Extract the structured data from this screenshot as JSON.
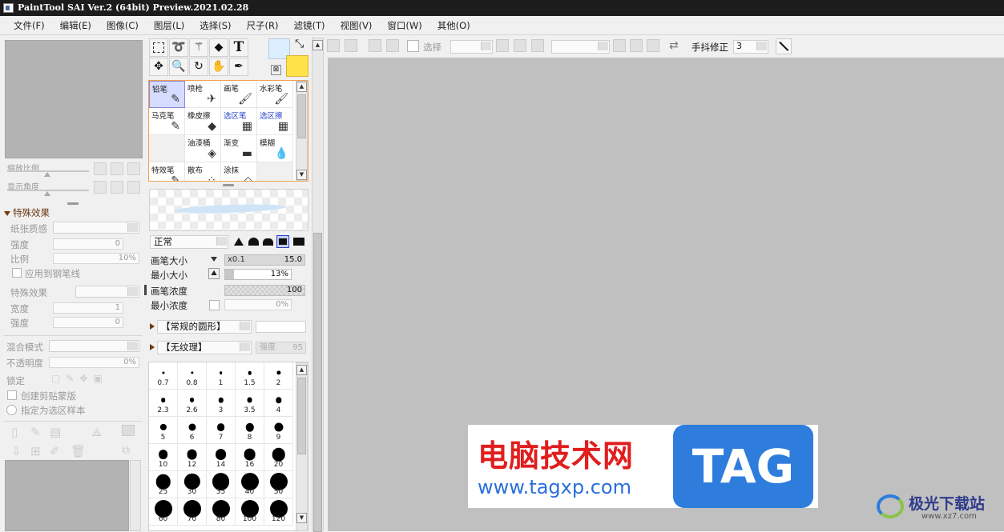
{
  "window": {
    "title": "PaintTool SAI Ver.2 (64bit) Preview.2021.02.28"
  },
  "menu": [
    "文件(F)",
    "编辑(E)",
    "图像(C)",
    "图层(L)",
    "选择(S)",
    "尺子(R)",
    "滤镜(T)",
    "视图(V)",
    "窗口(W)",
    "其他(O)"
  ],
  "nav": {
    "zoom_label": "缩放比例",
    "angle_label": "显示角度"
  },
  "effects": {
    "header": "特殊效果",
    "paper_label": "纸张质感",
    "strength_label": "强度",
    "strength_value": "0",
    "scale_label": "比例",
    "scale_value": "10%",
    "apply_pen_label": "应用到钢笔线",
    "effect_label": "特殊效果",
    "width_label": "宽度",
    "width_value": "1",
    "strength2_label": "强度",
    "strength2_value": "0"
  },
  "layer": {
    "blend_label": "混合模式",
    "opacity_label": "不透明度",
    "opacity_value": "0%",
    "lock_label": "锁定",
    "clip_label": "创建剪贴蒙版",
    "sample_label": "指定为选区样本"
  },
  "colors": {
    "fg": "#dbeeff",
    "bg": "#ffe24a",
    "accent": "#f0a050",
    "selected_tool": "#d6dcff"
  },
  "tools": {
    "grid": [
      {
        "name": "铅笔",
        "icon": "✎",
        "selected": true
      },
      {
        "name": "喷枪",
        "icon": "✈"
      },
      {
        "name": "画笔",
        "icon": "🖌"
      },
      {
        "name": "水彩笔",
        "icon": "🖌"
      },
      {
        "name": "马克笔",
        "icon": "✎"
      },
      {
        "name": "橡皮擦",
        "icon": "◆"
      },
      {
        "name": "选区笔",
        "icon": "▦",
        "blue": true
      },
      {
        "name": "选区擦",
        "icon": "▦",
        "blue": true
      },
      {
        "name": "",
        "icon": ""
      },
      {
        "name": "油漆桶",
        "icon": "◈"
      },
      {
        "name": "渐变",
        "icon": "▬"
      },
      {
        "name": "模糊",
        "icon": "💧"
      },
      {
        "name": "特效笔",
        "icon": "✎"
      },
      {
        "name": "散布",
        "icon": "⁘"
      },
      {
        "name": "涂抹",
        "icon": "◇"
      },
      {
        "name": "",
        "icon": ""
      }
    ]
  },
  "brush": {
    "mode": "正常",
    "size_label": "画笔大小",
    "size_mult": "x0.1",
    "size_value": "15.0",
    "min_size_label": "最小大小",
    "min_size_value": "13%",
    "density_label": "画笔浓度",
    "density_value": "100",
    "min_density_label": "最小浓度",
    "min_density_value": "0%",
    "shape": "【常规的圆形】",
    "texture": "【无纹理】",
    "texture_strength": "强度",
    "texture_strength_value": "95",
    "sizes": [
      "0.7",
      "0.8",
      "1",
      "1.5",
      "2",
      "2.3",
      "2.6",
      "3",
      "3.5",
      "4",
      "5",
      "6",
      "7",
      "8",
      "9",
      "10",
      "12",
      "14",
      "16",
      "20",
      "25",
      "30",
      "35",
      "40",
      "50",
      "60",
      "70",
      "80",
      "100",
      "120"
    ]
  },
  "toolbar": {
    "select_label": "选择",
    "stabilizer_label": "手抖修正",
    "stabilizer_value": "3"
  },
  "watermark": {
    "text_cn": "电脑技术网",
    "url": "www.tagxp.com",
    "tag": "TAG",
    "site": "极光下载站",
    "site_url": "www.xz7.com"
  }
}
